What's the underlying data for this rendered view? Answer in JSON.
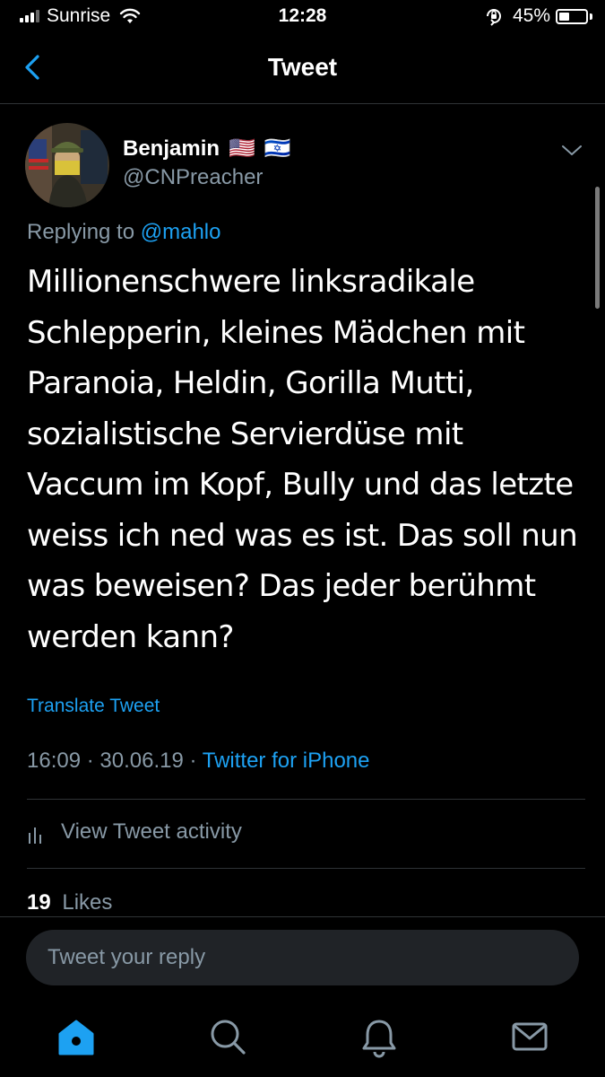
{
  "status_bar": {
    "carrier": "Sunrise",
    "time": "12:28",
    "battery": "45%",
    "battery_level": 0.45
  },
  "nav": {
    "title": "Tweet"
  },
  "tweet": {
    "author_name": "Benjamin",
    "flags": [
      "🇺🇸",
      "🇮🇱"
    ],
    "handle": "@CNPreacher",
    "replying_prefix": "Replying to",
    "replying_to": "@mahlo",
    "text": "Millionenschwere linksradikale Schlepperin, kleines Mädchen mit Paranoia, Heldin, Gorilla Mutti, sozialistische Servierdüse mit Vaccum im Kopf, Bully und das letzte weiss ich ned was es ist. Das soll nun was beweisen? Das jeder berühmt werden kann?",
    "translate_label": "Translate Tweet",
    "time": "16:09",
    "date": "30.06.19",
    "separator": "·",
    "source": "Twitter for iPhone",
    "activity_label": "View Tweet activity",
    "likes_count": "19",
    "likes_label": "Likes"
  },
  "reply": {
    "placeholder": "Tweet your reply"
  },
  "tabbar": {
    "items": [
      "home-icon",
      "search-icon",
      "notifications-icon",
      "messages-icon"
    ],
    "active_color": "#1da1f2",
    "inactive_color": "#8899a6"
  },
  "colors": {
    "background": "#000000",
    "accent": "#1da1f2",
    "secondary_text": "#8899a6",
    "divider": "#2f3336"
  }
}
